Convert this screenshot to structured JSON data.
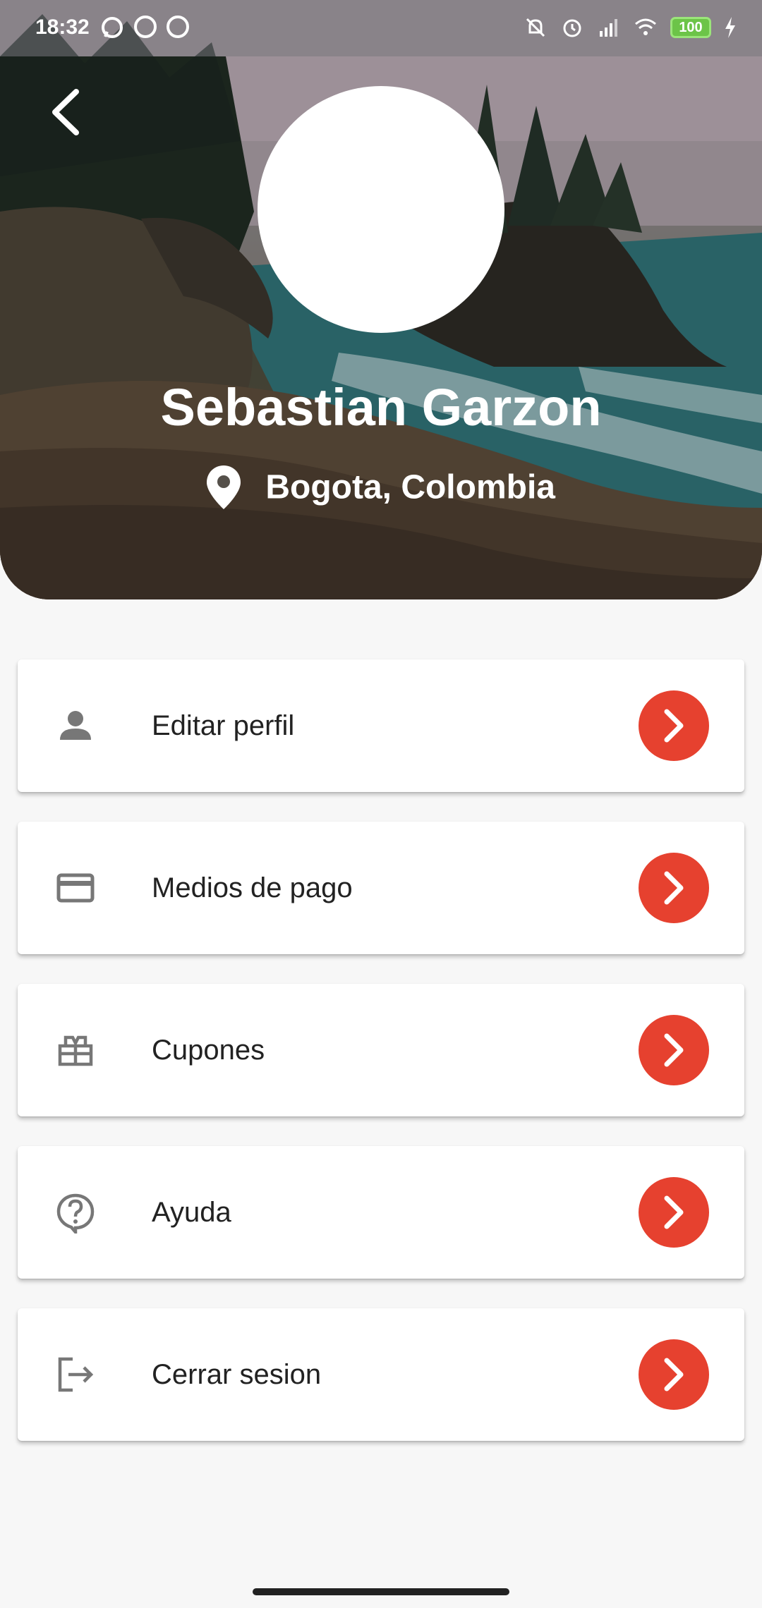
{
  "status_bar": {
    "time": "18:32",
    "battery": "100",
    "icons": [
      "whatsapp-icon",
      "app-notification-icon",
      "app-notification-icon",
      "mute-icon",
      "alarm-icon",
      "signal-icon",
      "wifi-icon",
      "battery-icon",
      "charging-icon"
    ]
  },
  "profile": {
    "name": "Sebastian Garzon",
    "location": "Bogota, Colombia"
  },
  "menu": [
    {
      "label": "Editar perfil",
      "icon": "person-icon"
    },
    {
      "label": "Medios de pago",
      "icon": "credit-card-icon"
    },
    {
      "label": "Cupones",
      "icon": "gift-icon"
    },
    {
      "label": "Ayuda",
      "icon": "help-icon"
    },
    {
      "label": "Cerrar sesion",
      "icon": "logout-icon"
    }
  ],
  "colors": {
    "accent": "#e6412f",
    "background": "#f7f7f7",
    "card": "#ffffff",
    "icon": "#777777"
  }
}
